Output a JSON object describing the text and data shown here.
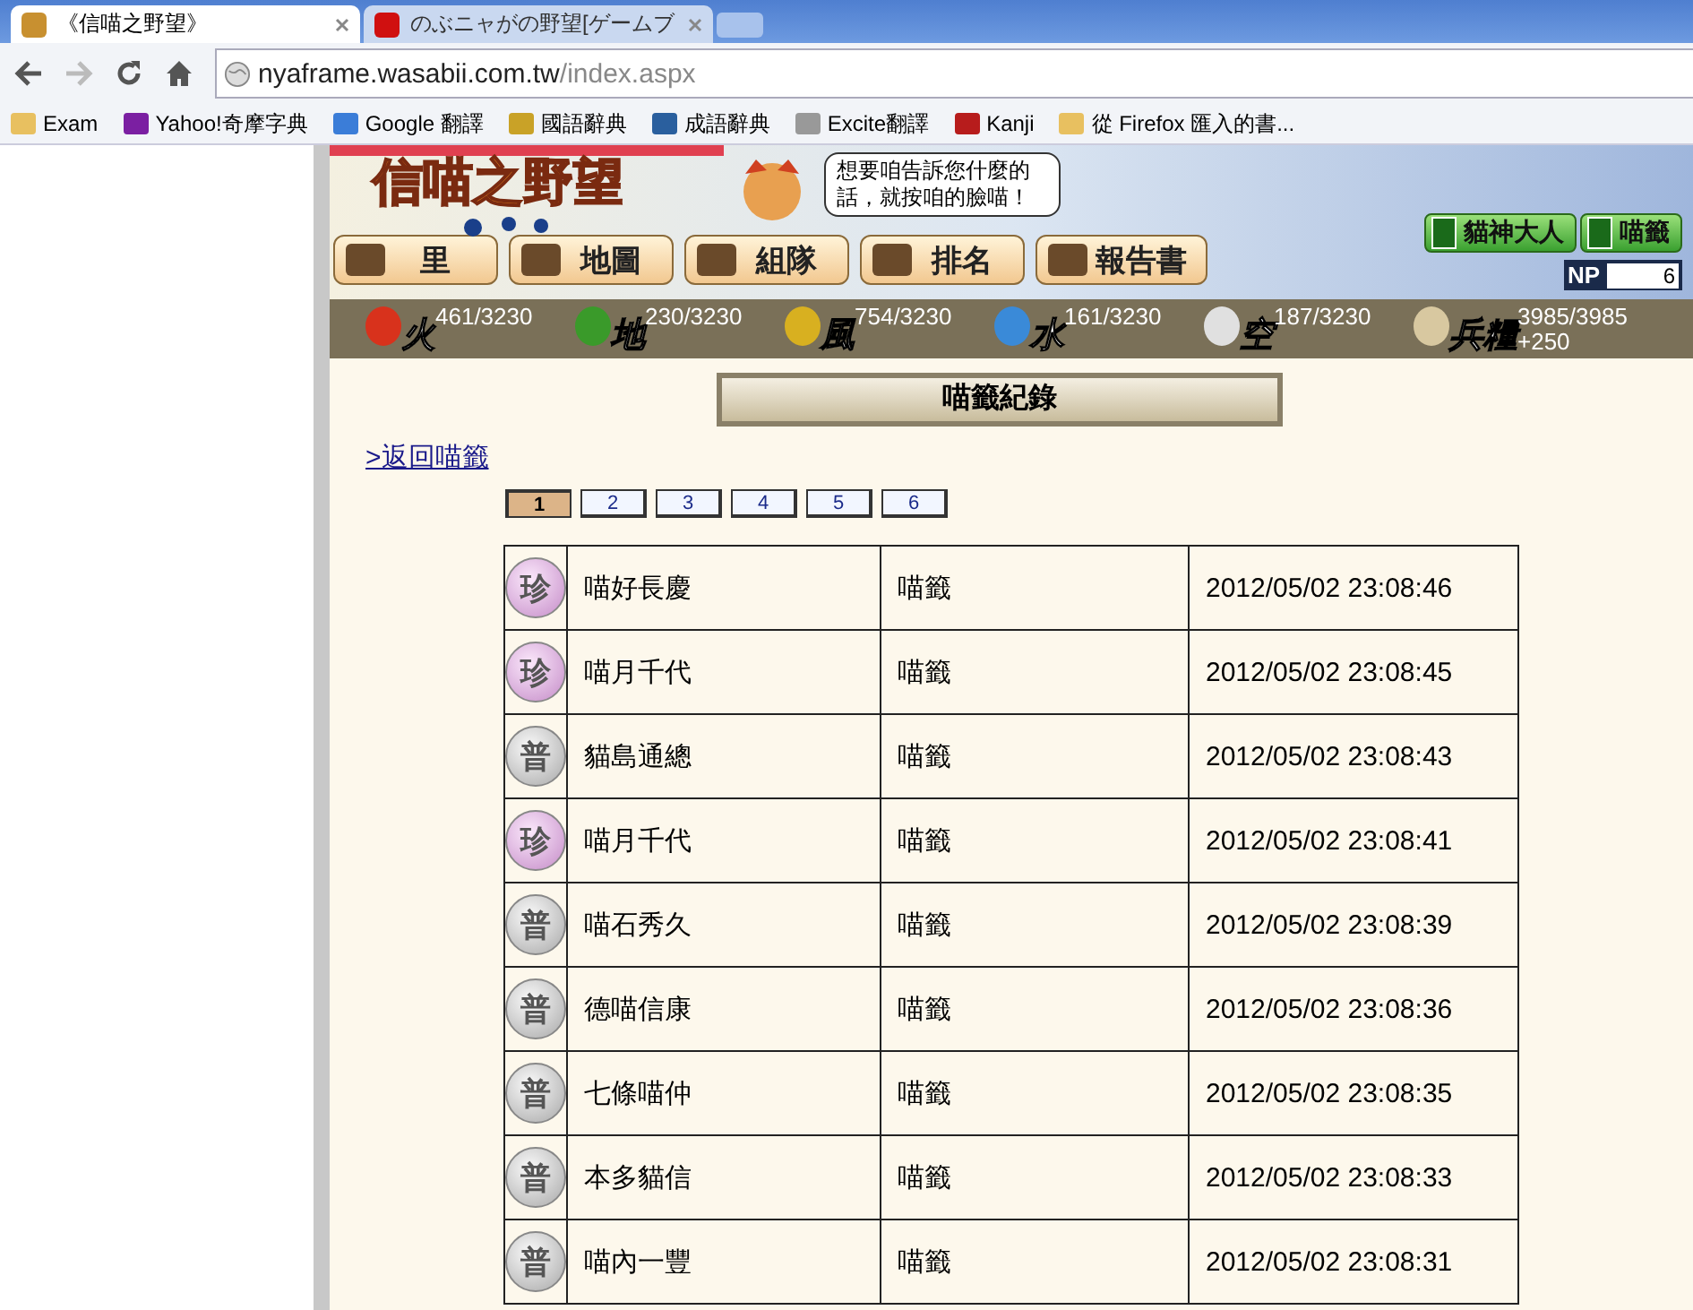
{
  "browser": {
    "tabs": [
      {
        "title": "《信喵之野望》",
        "selected": true
      },
      {
        "title": "のぶニャがの野望[ゲームブ",
        "selected": false
      }
    ],
    "address": {
      "host": "nyaframe.wasabii.com.tw",
      "path": "/index.aspx"
    },
    "bookmarks": [
      {
        "label": "Exam",
        "kind": "folder"
      },
      {
        "label": "Yahoo!奇摩字典",
        "kind": "yahoo"
      },
      {
        "label": "Google 翻譯",
        "kind": "translate"
      },
      {
        "label": "國語辭典",
        "kind": "dict"
      },
      {
        "label": "成語辭典",
        "kind": "idiom"
      },
      {
        "label": "Excite翻譯",
        "kind": "excite"
      },
      {
        "label": "Kanji",
        "kind": "kanji"
      },
      {
        "label": "從 Firefox 匯入的書...",
        "kind": "folder"
      }
    ]
  },
  "header": {
    "logo": "信喵之野望",
    "bubble": "想要咱告訴您什麼的話，就按咱的臉喵！",
    "nav": [
      "里",
      "地圖",
      "組隊",
      "排名",
      "報告書"
    ],
    "side_buttons": [
      "貓神大人",
      "喵籤"
    ],
    "np_label": "NP",
    "np_value": "6"
  },
  "resources": [
    {
      "label": "火",
      "value": "461/3230",
      "kind": "fire"
    },
    {
      "label": "地",
      "value": "230/3230",
      "kind": "earth"
    },
    {
      "label": "風",
      "value": "754/3230",
      "kind": "wind"
    },
    {
      "label": "水",
      "value": "161/3230",
      "kind": "water"
    },
    {
      "label": "空",
      "value": "187/3230",
      "kind": "sky"
    },
    {
      "label": "兵糧",
      "value": "3985/3985",
      "extra": "+250",
      "kind": "food"
    }
  ],
  "title": "喵籤紀錄",
  "back_link": ">返回喵籤",
  "pages": [
    {
      "label": "1",
      "selected": true
    },
    {
      "label": "2",
      "selected": false
    },
    {
      "label": "3",
      "selected": false
    },
    {
      "label": "4",
      "selected": false
    },
    {
      "label": "5",
      "selected": false
    },
    {
      "label": "6",
      "selected": false
    }
  ],
  "rows": [
    {
      "rarity": "珍",
      "kind": "rare",
      "name": "喵好長慶",
      "type": "喵籤",
      "time": "2012/05/02 23:08:46"
    },
    {
      "rarity": "珍",
      "kind": "rare",
      "name": "喵月千代",
      "type": "喵籤",
      "time": "2012/05/02 23:08:45"
    },
    {
      "rarity": "普",
      "kind": "common",
      "name": "貓島通總",
      "type": "喵籤",
      "time": "2012/05/02 23:08:43"
    },
    {
      "rarity": "珍",
      "kind": "rare",
      "name": "喵月千代",
      "type": "喵籤",
      "time": "2012/05/02 23:08:41"
    },
    {
      "rarity": "普",
      "kind": "common",
      "name": "喵石秀久",
      "type": "喵籤",
      "time": "2012/05/02 23:08:39"
    },
    {
      "rarity": "普",
      "kind": "common",
      "name": "德喵信康",
      "type": "喵籤",
      "time": "2012/05/02 23:08:36"
    },
    {
      "rarity": "普",
      "kind": "common",
      "name": "七條喵仲",
      "type": "喵籤",
      "time": "2012/05/02 23:08:35"
    },
    {
      "rarity": "普",
      "kind": "common",
      "name": "本多貓信",
      "type": "喵籤",
      "time": "2012/05/02 23:08:33"
    },
    {
      "rarity": "普",
      "kind": "common",
      "name": "喵內一豐",
      "type": "喵籤",
      "time": "2012/05/02 23:08:31"
    }
  ]
}
